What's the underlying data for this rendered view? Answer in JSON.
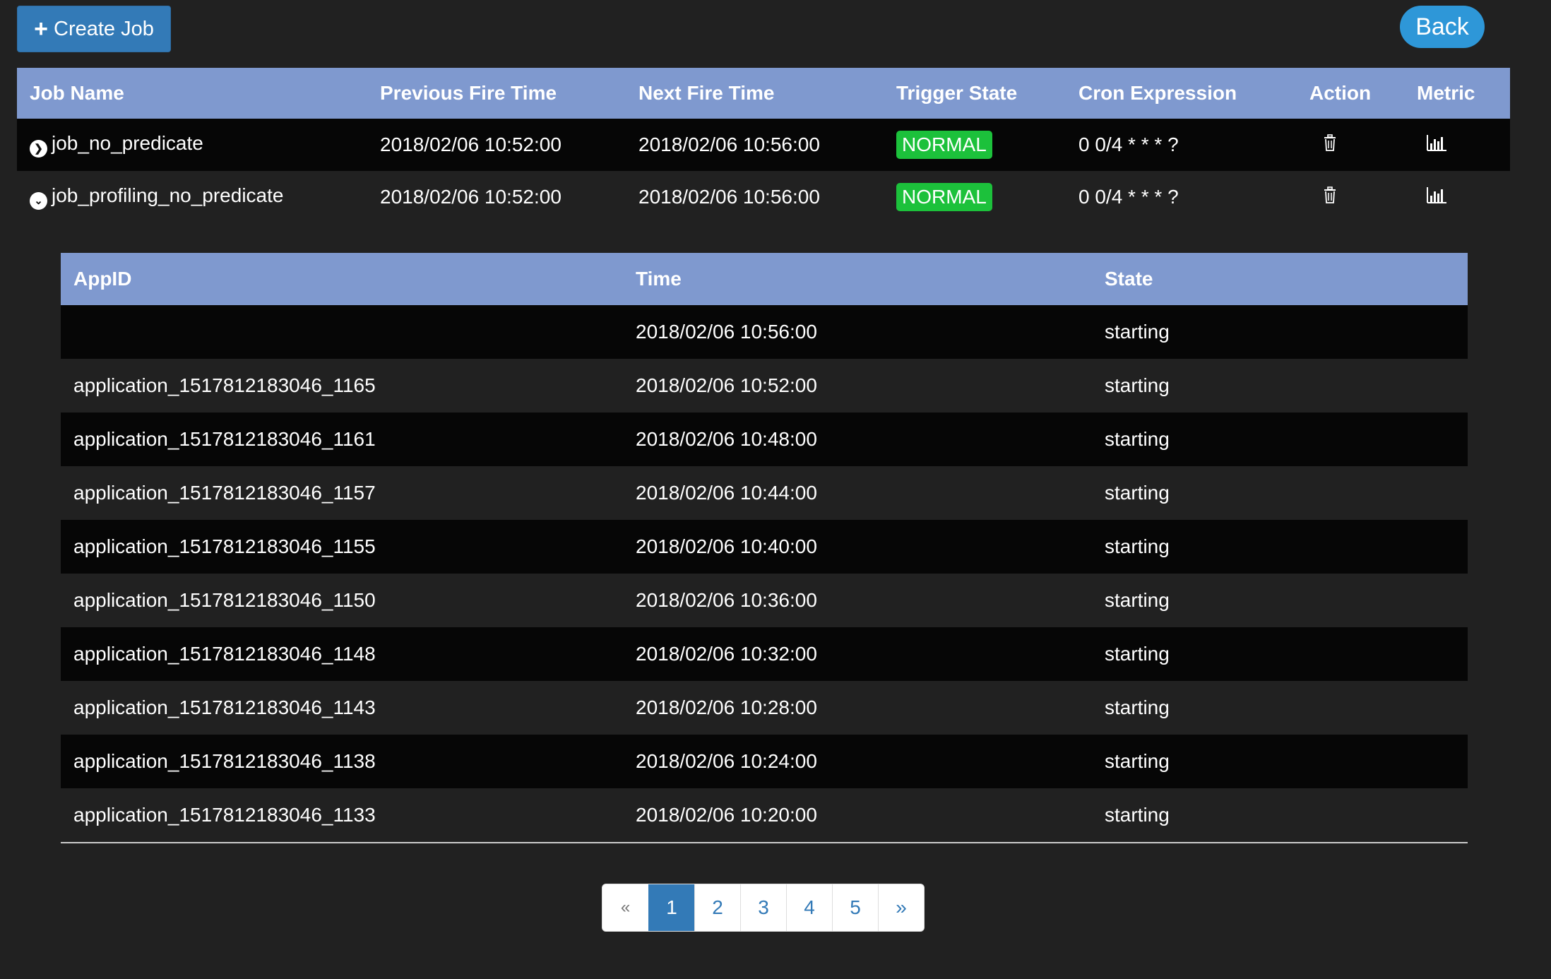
{
  "toolbar": {
    "create_label": "Create Job",
    "back_label": "Back"
  },
  "jobs": {
    "headers": [
      "Job Name",
      "Previous Fire Time",
      "Next Fire Time",
      "Trigger State",
      "Cron Expression",
      "Action",
      "Metric"
    ],
    "rows": [
      {
        "name": "job_no_predicate",
        "expander_icon": "chevron-right-circle-icon",
        "previous": "2018/02/06 10:52:00",
        "next": "2018/02/06 10:56:00",
        "state": "NORMAL",
        "cron": "0 0/4 * * * ?"
      },
      {
        "name": "job_profiling_no_predicate",
        "expander_icon": "chevron-down-circle-icon",
        "previous": "2018/02/06 10:52:00",
        "next": "2018/02/06 10:56:00",
        "state": "NORMAL",
        "cron": "0 0/4 * * * ?"
      }
    ]
  },
  "instances": {
    "headers": [
      "AppID",
      "Time",
      "State"
    ],
    "rows": [
      {
        "appid": "",
        "time": "2018/02/06 10:56:00",
        "state": "starting"
      },
      {
        "appid": "application_1517812183046_1165",
        "time": "2018/02/06 10:52:00",
        "state": "starting"
      },
      {
        "appid": "application_1517812183046_1161",
        "time": "2018/02/06 10:48:00",
        "state": "starting"
      },
      {
        "appid": "application_1517812183046_1157",
        "time": "2018/02/06 10:44:00",
        "state": "starting"
      },
      {
        "appid": "application_1517812183046_1155",
        "time": "2018/02/06 10:40:00",
        "state": "starting"
      },
      {
        "appid": "application_1517812183046_1150",
        "time": "2018/02/06 10:36:00",
        "state": "starting"
      },
      {
        "appid": "application_1517812183046_1148",
        "time": "2018/02/06 10:32:00",
        "state": "starting"
      },
      {
        "appid": "application_1517812183046_1143",
        "time": "2018/02/06 10:28:00",
        "state": "starting"
      },
      {
        "appid": "application_1517812183046_1138",
        "time": "2018/02/06 10:24:00",
        "state": "starting"
      },
      {
        "appid": "application_1517812183046_1133",
        "time": "2018/02/06 10:20:00",
        "state": "starting"
      }
    ]
  },
  "pagination": {
    "prev": "«",
    "pages": [
      "1",
      "2",
      "3",
      "4",
      "5"
    ],
    "active": "1",
    "next": "»"
  },
  "colors": {
    "background": "#212121",
    "header": "#7f99cf",
    "primary": "#337ab7",
    "badge_normal": "#1cc13b"
  }
}
